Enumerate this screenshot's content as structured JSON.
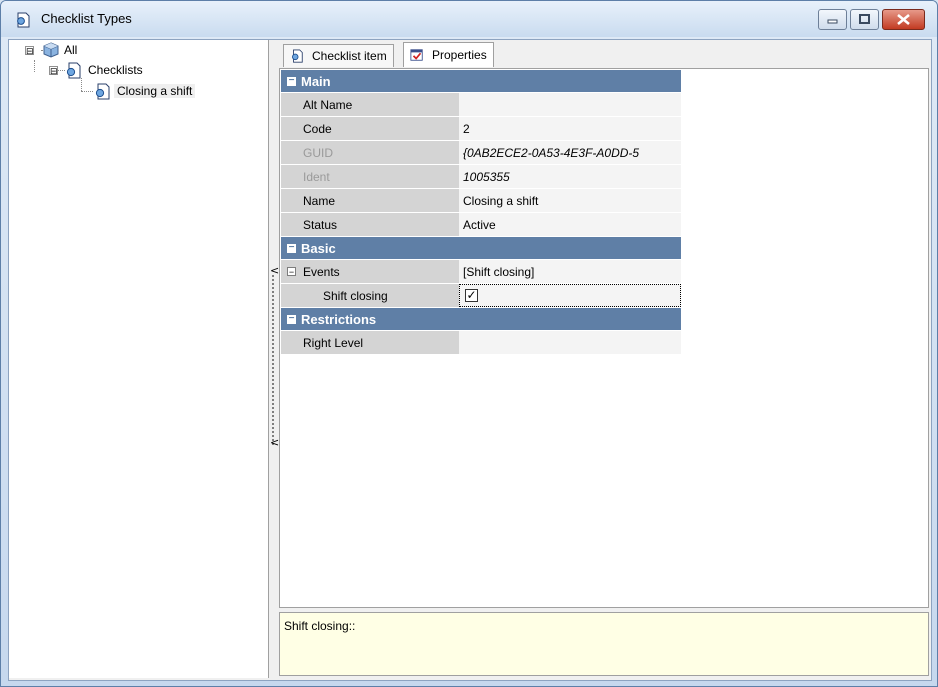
{
  "window": {
    "title": "Checklist Types",
    "icon": "checklist-type-icon"
  },
  "tree": {
    "root": {
      "label": "All",
      "expander": "⊟"
    },
    "group": {
      "label": "Checklists",
      "expander": "⊟"
    },
    "item": {
      "label": "Closing a shift"
    }
  },
  "tabs": [
    {
      "label": "Checklist item",
      "active": false
    },
    {
      "label": "Properties",
      "active": true
    }
  ],
  "properties": {
    "main": {
      "title": "Main",
      "rows": [
        {
          "name": "Alt Name",
          "value": ""
        },
        {
          "name": "Code",
          "value": "2"
        },
        {
          "name": "GUID",
          "value": "{0AB2ECE2-0A53-4E3F-A0DD-5"
        },
        {
          "name": "Ident",
          "value": "1005355"
        },
        {
          "name": "Name",
          "value": "Closing a shift"
        },
        {
          "name": "Status",
          "value": "Active"
        }
      ]
    },
    "basic": {
      "title": "Basic",
      "events": {
        "name": "Events",
        "value": "[Shift closing]"
      },
      "shift_closing": {
        "name": "Shift closing",
        "checked": "✓"
      }
    },
    "restrictions": {
      "title": "Restrictions",
      "rows": [
        {
          "name": "Right Level",
          "value": ""
        }
      ]
    }
  },
  "description": "Shift closing::",
  "splitter": {
    "arrow": "<"
  },
  "colors": {
    "category_bg": "#5f7fa6",
    "description_bg": "#ffffe5",
    "key_bg": "#d4d4d4"
  }
}
